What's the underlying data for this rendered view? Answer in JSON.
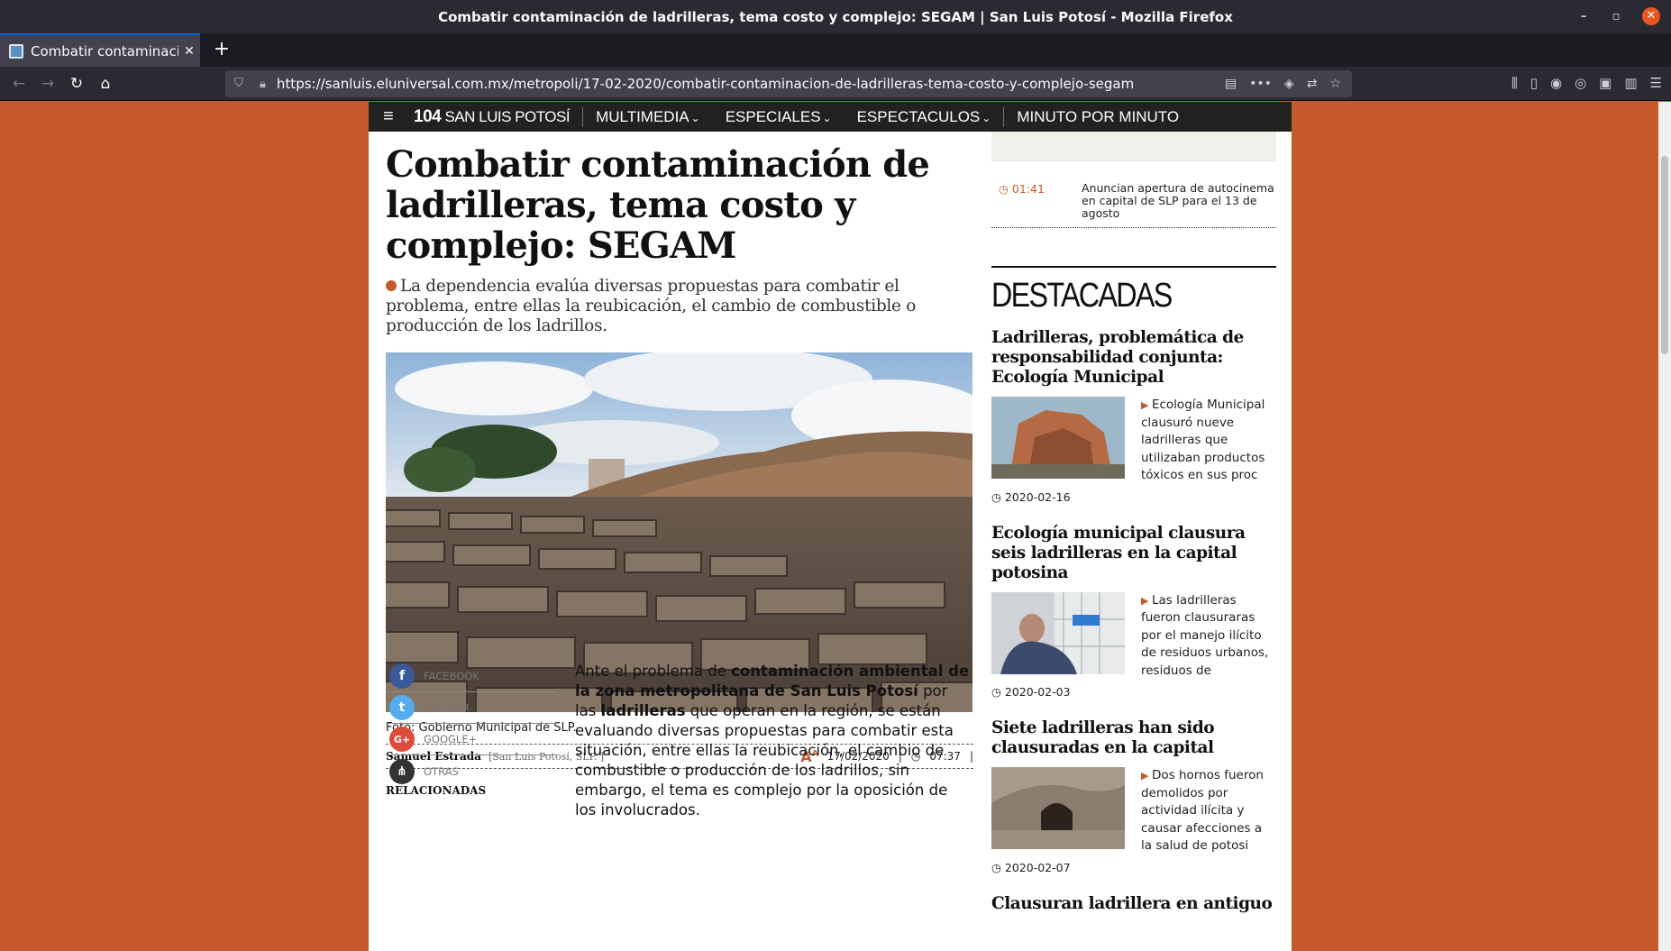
{
  "window": {
    "title": "Combatir contaminación de ladrilleras, tema costo y complejo: SEGAM | San Luis Potosí - Mozilla Firefox"
  },
  "tab": {
    "label": "Combatir contaminación",
    "close": "✕",
    "new": "+"
  },
  "urlbar": {
    "url": "https://sanluis.eluniversal.com.mx/metropoli/17-02-2020/combatir-contaminacion-de-ladrilleras-tema-costo-y-complejo-segam"
  },
  "sitenav": {
    "logo_num": "104",
    "logo_text": "SAN LUIS POTOSÍ",
    "items": [
      "MULTIMEDIA",
      "ESPECIALES",
      "ESPECTACULOS",
      "MINUTO POR MINUTO"
    ]
  },
  "article": {
    "headline": "Combatir contaminación de ladrilleras, tema costo y complejo: SEGAM",
    "summary": "La dependencia evalúa diversas propuestas para combatir el problema, entre ellas la reubicación, el cambio de combustible o producción de los ladrillos.",
    "caption": "Foto: Gobierno Municipal de SLP.",
    "author": "Samuel Estrada",
    "location": "[San Luis Potosí, SLP. ]",
    "date": "17/02/2020",
    "time": "07:37",
    "share": [
      "FACEBOOK",
      "TWITTER",
      "GOOGLE+",
      "OTRAS"
    ],
    "related_heading": "RELACIONADAS",
    "body": {
      "p1": "Ante el problema de ",
      "b1": "contaminación ambiental de la zona metropolitana de San Luis Potosí",
      "p2": " por las ",
      "b2": "ladrilleras",
      "p3": " que operan en la región, se están evaluando diversas propuestas para combatir esta situación, entre ellas la reubicación, el cambio de combustible o producción de los ladrillos, sin embargo, el tema es complejo por la oposición de los involucrados."
    }
  },
  "sidebar": {
    "minuto": {
      "time": "01:41",
      "text": "Anuncian apertura de autocinema en capital de SLP para el 13 de agosto"
    },
    "destacadas_title": "DESTACADAS",
    "items": [
      {
        "title": "Ladrilleras, problemática de responsabilidad conjunta: Ecología Municipal",
        "desc": "Ecología Municipal clausuró nueve ladrilleras que utilizaban productos tóxicos en sus proc",
        "date": "2020-02-16"
      },
      {
        "title": "Ecología municipal clausura seis ladrilleras en la capital potosina",
        "desc": "Las ladrilleras fueron clausuraras por el manejo ilícito de residuos urbanos, residuos de",
        "date": "2020-02-03"
      },
      {
        "title": "Siete ladrilleras han sido clausuradas en la capital",
        "desc": "Dos hornos fueron demolidos por actividad ilícita y causar afecciones a la salud de potosi",
        "date": "2020-02-07"
      },
      {
        "title": "Clausuran ladrillera en antiguo",
        "desc": "",
        "date": ""
      }
    ]
  }
}
